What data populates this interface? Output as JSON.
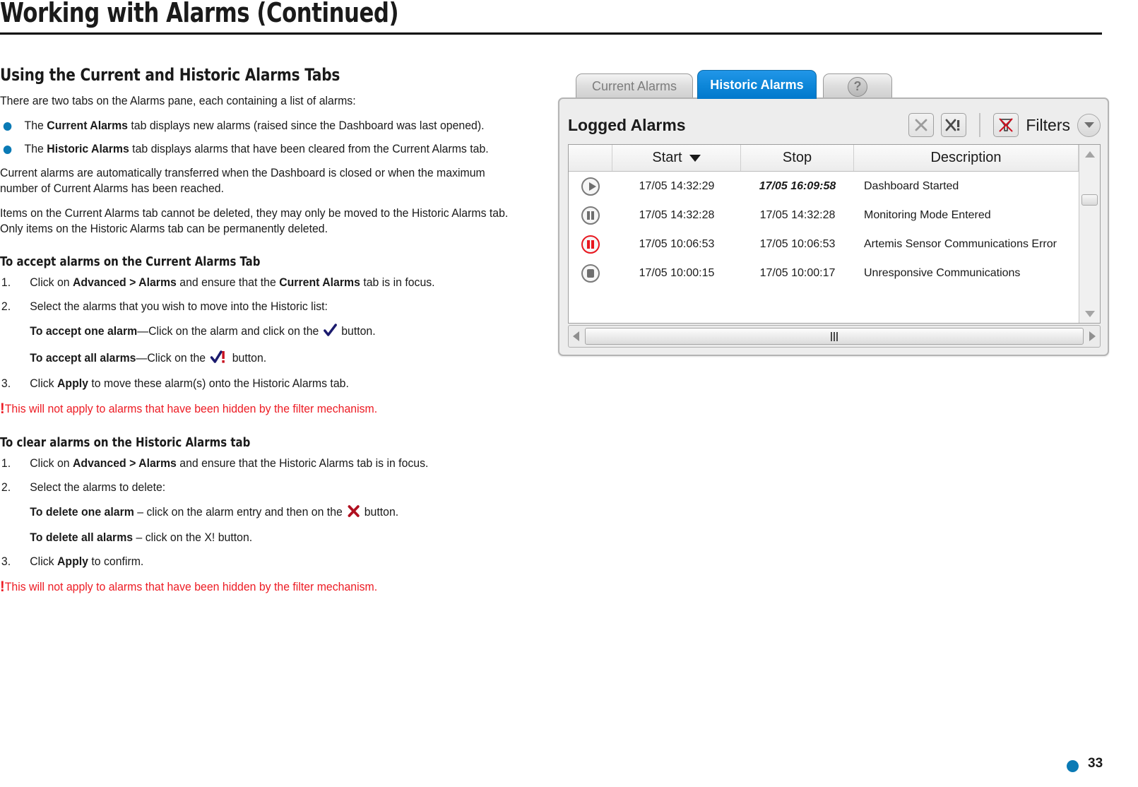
{
  "document": {
    "title": "Working with Alarms (Continued)",
    "page_number": "33"
  },
  "content": {
    "section_heading": "Using the Current and Historic Alarms Tabs",
    "intro": "There are two tabs on the Alarms pane, each containing a list of alarms:",
    "bullets": [
      {
        "pre": "The ",
        "bold": "Current Alarms",
        "post": " tab displays new alarms (raised since the Dashboard was last opened)."
      },
      {
        "pre": "The ",
        "bold": "Historic Alarms",
        "post": " tab displays alarms that have been cleared from the Current Alarms tab."
      }
    ],
    "para_transfer": "Current alarms are automatically transferred when the Dashboard is closed or when the maximum number of Current Alarms has been reached.",
    "para_delete": "Items on the Current Alarms tab cannot be deleted, they may only be moved to the Historic Alarms tab. Only items on the Historic Alarms tab can be permanently deleted.",
    "accept": {
      "heading": "To accept alarms on the Current Alarms Tab",
      "step1_num": "1.",
      "step1_a": "Click on ",
      "step1_b1": "Advanced > Alarms",
      "step1_c": " and ensure that the ",
      "step1_b2": "Current Alarms",
      "step1_d": " tab is in focus.",
      "step2_num": "2.",
      "step2_text": "Select the alarms that you wish to move into the Historic list:",
      "sub1_bold": "To accept one alarm",
      "sub1_text": "—Click on the alarm and click on the",
      "sub1_tail": "button.",
      "sub2_bold": "To accept all alarms",
      "sub2_text": "—Click on the",
      "sub2_tail": "button.",
      "step3_num": "3.",
      "step3_a": "Click ",
      "step3_b": "Apply",
      "step3_c": " to move these alarm(s) onto the Historic Alarms tab.",
      "note": "This will not apply to alarms that have been hidden by the filter mechanism."
    },
    "clear": {
      "heading": "To clear alarms on the Historic Alarms tab",
      "step1_num": "1.",
      "step1_a": "Click on ",
      "step1_b1": "Advanced > Alarms",
      "step1_c": " and ensure that the Historic Alarms tab is in focus.",
      "step2_num": "2.",
      "step2_text": "Select the alarms to delete:",
      "sub1_bold": "To delete one alarm",
      "sub1_text": " – click on the alarm entry and then on the",
      "sub1_tail": "button.",
      "sub2_bold": "To delete all alarms",
      "sub2_text": " – click on the X! button.",
      "step3_num": "3.",
      "step3_a": "Click ",
      "step3_b": "Apply",
      "step3_c": " to confirm.",
      "note": "This will not apply to alarms that have been hidden by the filter mechanism."
    },
    "icons": {
      "accept_one": "check-icon",
      "accept_all": "check-bang-icon",
      "delete_one": "x-cross-icon",
      "note_bang": "exclamation-icon"
    }
  },
  "app": {
    "tabs": [
      {
        "label": "Current Alarms",
        "active": false,
        "name": "tab-current-alarms"
      },
      {
        "label": "Historic Alarms",
        "active": true,
        "name": "tab-historic-alarms"
      },
      {
        "label": "?",
        "active": false,
        "name": "tab-help"
      }
    ],
    "panel": {
      "title": "Logged Alarms",
      "toolbar": {
        "delete_one_label": "X",
        "delete_all_label": "X!",
        "filters_label": "Filters",
        "filter_icon": "funnel-disabled-icon",
        "dropdown_icon": "chevron-down-icon"
      },
      "grid": {
        "columns": [
          "",
          "Start",
          "Stop",
          "Description"
        ],
        "sort_column": "Start",
        "sort_icon": "caret-down-icon",
        "rows": [
          {
            "status": "play",
            "status_color": "#6e6e6e",
            "start": "17/05 14:32:29",
            "stop": "17/05 16:09:58",
            "stop_italic": true,
            "description": "Dashboard Started"
          },
          {
            "status": "pause",
            "status_color": "#6e6e6e",
            "start": "17/05 14:32:28",
            "stop": "17/05 14:32:28",
            "stop_italic": false,
            "description": "Monitoring Mode Entered"
          },
          {
            "status": "pause",
            "status_color": "#e8171f",
            "start": "17/05 10:06:53",
            "stop": "17/05 10:06:53",
            "stop_italic": false,
            "description": "Artemis Sensor Communications Error"
          },
          {
            "status": "stop",
            "status_color": "#6e6e6e",
            "start": "17/05 10:00:15",
            "stop": "17/05 10:00:17",
            "stop_italic": false,
            "description": "Unresponsive Communications"
          }
        ]
      },
      "scrollbars": {
        "vertical_up_icon": "triangle-up-icon",
        "vertical_down_icon": "triangle-down-icon",
        "horizontal_left_icon": "triangle-left-icon",
        "horizontal_right_icon": "triangle-right-icon",
        "grip_icon": "grip-icon"
      }
    }
  },
  "colors": {
    "accent_blue": "#0a7ab5",
    "tab_active_blue": "#0d86d8",
    "alert_red": "#ed1c24",
    "status_red": "#e8171f"
  }
}
